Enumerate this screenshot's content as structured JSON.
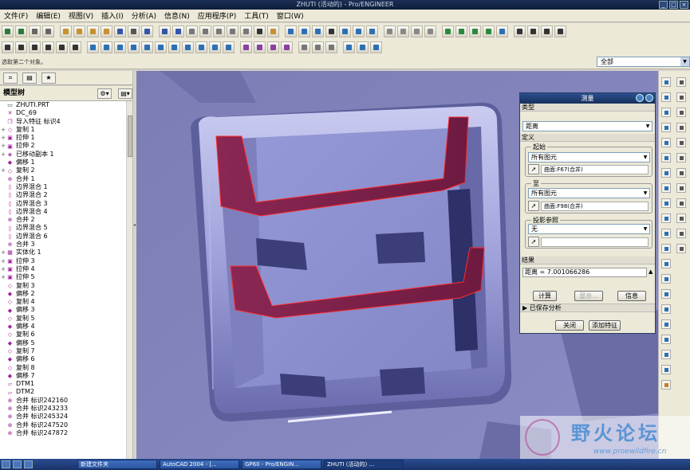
{
  "window": {
    "title": "ZHUTI (活动的) - Pro/ENGINEER"
  },
  "menu": [
    "文件(F)",
    "编辑(E)",
    "视图(V)",
    "插入(I)",
    "分析(A)",
    "信息(N)",
    "应用程序(P)",
    "工具(T)",
    "窗口(W)"
  ],
  "status": {
    "message": "选取第二个对象。",
    "filter": "全部"
  },
  "model_tree": {
    "title": "模型树",
    "items": [
      {
        "label": "ZHUTI.PRT",
        "icon": "part-icon",
        "expand": ""
      },
      {
        "label": "DC_69",
        "icon": "coord-icon",
        "expand": ""
      },
      {
        "label": "导入特征 标识4",
        "icon": "import-icon",
        "expand": ""
      },
      {
        "label": "复制 1",
        "icon": "copy-icon",
        "expand": "+"
      },
      {
        "label": "拉伸 1",
        "icon": "extrude-icon",
        "expand": "+"
      },
      {
        "label": "拉伸 2",
        "icon": "extrude-icon",
        "expand": "+"
      },
      {
        "label": "已移动副本 1",
        "icon": "moved-copy-icon",
        "expand": "+"
      },
      {
        "label": "偏移 1",
        "icon": "offset-icon",
        "expand": ""
      },
      {
        "label": "复制 2",
        "icon": "copy-icon",
        "expand": "+"
      },
      {
        "label": "合并 1",
        "icon": "merge-icon",
        "expand": ""
      },
      {
        "label": "边界混合 1",
        "icon": "blend-icon",
        "expand": ""
      },
      {
        "label": "边界混合 2",
        "icon": "blend-icon",
        "expand": ""
      },
      {
        "label": "边界混合 3",
        "icon": "blend-icon",
        "expand": ""
      },
      {
        "label": "边界混合 4",
        "icon": "blend-icon",
        "expand": ""
      },
      {
        "label": "合并 2",
        "icon": "merge-icon",
        "expand": ""
      },
      {
        "label": "边界混合 5",
        "icon": "blend-icon",
        "expand": ""
      },
      {
        "label": "边界混合 6",
        "icon": "blend-icon",
        "expand": ""
      },
      {
        "label": "合并 3",
        "icon": "merge-icon",
        "expand": ""
      },
      {
        "label": "实体化 1",
        "icon": "solidify-icon",
        "expand": "+"
      },
      {
        "label": "拉伸 3",
        "icon": "extrude-icon",
        "expand": "+"
      },
      {
        "label": "拉伸 4",
        "icon": "extrude-icon",
        "expand": "+"
      },
      {
        "label": "拉伸 5",
        "icon": "extrude-icon",
        "expand": "+"
      },
      {
        "label": "复制 3",
        "icon": "copy-icon",
        "expand": ""
      },
      {
        "label": "偏移 2",
        "icon": "offset-icon",
        "expand": ""
      },
      {
        "label": "复制 4",
        "icon": "copy-icon",
        "expand": ""
      },
      {
        "label": "偏移 3",
        "icon": "offset-icon",
        "expand": ""
      },
      {
        "label": "复制 5",
        "icon": "copy-icon",
        "expand": ""
      },
      {
        "label": "偏移 4",
        "icon": "offset-icon",
        "expand": ""
      },
      {
        "label": "复制 6",
        "icon": "copy-icon",
        "expand": ""
      },
      {
        "label": "偏移 5",
        "icon": "offset-icon",
        "expand": ""
      },
      {
        "label": "复制 7",
        "icon": "copy-icon",
        "expand": ""
      },
      {
        "label": "偏移 6",
        "icon": "offset-icon",
        "expand": ""
      },
      {
        "label": "复制 8",
        "icon": "copy-icon",
        "expand": ""
      },
      {
        "label": "偏移 7",
        "icon": "offset-icon",
        "expand": ""
      },
      {
        "label": "DTM1",
        "icon": "datum-plane-icon",
        "expand": ""
      },
      {
        "label": "DTM2",
        "icon": "datum-plane-icon",
        "expand": ""
      },
      {
        "label": "合并 标识242160",
        "icon": "merge-icon",
        "expand": ""
      },
      {
        "label": "合并 标识243233",
        "icon": "merge-icon",
        "expand": ""
      },
      {
        "label": "合并 标识245324",
        "icon": "merge-icon",
        "expand": ""
      },
      {
        "label": "合并 标识247520",
        "icon": "merge-icon",
        "expand": ""
      },
      {
        "label": "合并 标识247872",
        "icon": "merge-icon",
        "expand": ""
      }
    ]
  },
  "measure_dialog": {
    "title": "测量",
    "type_label": "类型",
    "type_value": "距离",
    "define_label": "定义",
    "from_label": "起始",
    "from_value": "所有图元",
    "from_selection": "曲面:F67(合并)",
    "to_label": "至",
    "to_value": "所有图元",
    "to_selection": "曲面:F98(合并)",
    "projection_label": "投影参照",
    "projection_value": "无",
    "result_label": "结果",
    "result_value": "距离 = 7.001066286",
    "compute_button": "计算",
    "show_button": "显示...",
    "info_button": "信息",
    "saved_analysis": "已保存分析",
    "close_button": "关闭",
    "add_feature_button": "添加特征"
  },
  "taskbar": {
    "tasks": [
      "新建文件夹",
      "AutoCAD 2004 - [...",
      "GP60 - Pro/ENGIN...",
      "ZHUTI (活动的) ..."
    ]
  },
  "colors": {
    "viewport_bg": "#8183b9",
    "selected_surface": "#7d2148",
    "model_face": "#8c8fd0"
  }
}
